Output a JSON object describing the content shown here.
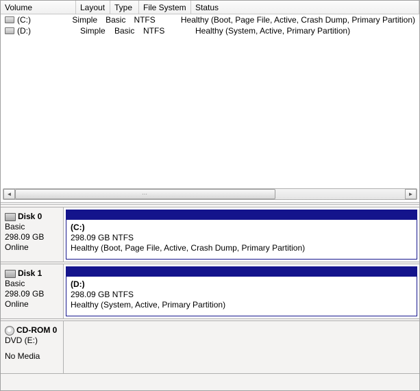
{
  "columns": {
    "volume": "Volume",
    "layout": "Layout",
    "type": "Type",
    "filesystem": "File System",
    "status": "Status"
  },
  "volumes": [
    {
      "name": "(C:)",
      "layout": "Simple",
      "type": "Basic",
      "fs": "NTFS",
      "status": "Healthy (Boot, Page File, Active, Crash Dump, Primary Partition)"
    },
    {
      "name": "(D:)",
      "layout": "Simple",
      "type": "Basic",
      "fs": "NTFS",
      "status": "Healthy (System, Active, Primary Partition)"
    }
  ],
  "disks": [
    {
      "title": "Disk 0",
      "type": "Basic",
      "size": "298.09 GB",
      "state": "Online",
      "icon": "disk",
      "partitions": [
        {
          "name": "(C:)",
          "sizefs": "298.09 GB NTFS",
          "status": "Healthy (Boot, Page File, Active, Crash Dump, Primary Partition)"
        }
      ]
    },
    {
      "title": "Disk 1",
      "type": "Basic",
      "size": "298.09 GB",
      "state": "Online",
      "icon": "disk",
      "partitions": [
        {
          "name": "(D:)",
          "sizefs": "298.09 GB NTFS",
          "status": "Healthy (System, Active, Primary Partition)"
        }
      ]
    },
    {
      "title": "CD-ROM 0",
      "type": "DVD (E:)",
      "size": "",
      "state": "No Media",
      "icon": "cd",
      "partitions": []
    }
  ]
}
